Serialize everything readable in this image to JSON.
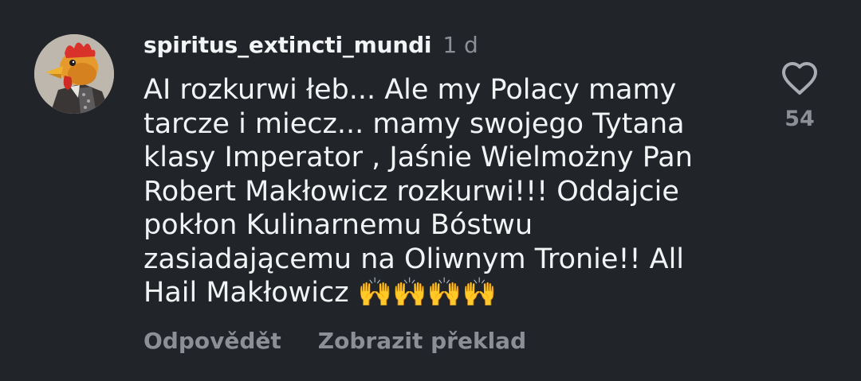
{
  "comment": {
    "author": "spiritus_extincti_mundi",
    "time": "1 d",
    "text": "AI rozkurwi łeb... Ale my Polacy mamy\ntarcze i miecz... mamy swojego Tytana\nklasy Imperator , Jaśnie Wielmożny Pan\nRobert Makłowicz rozkurwi!!! Oddajcie\npokłon Kulinarnemu Bóstwu\nzasiadającemu na Oliwnym Tronie!! All\nHail Makłowicz 🙌🙌🙌🙌",
    "avatar_icon": "rooster-mask-avatar"
  },
  "actions": {
    "reply": "Odpovědět",
    "translate": "Zobrazit překlad"
  },
  "like": {
    "icon": "heart-icon",
    "count": "54"
  },
  "colors": {
    "background": "#212429",
    "text_primary": "#f2f3f5",
    "text_secondary": "#8c9096"
  }
}
